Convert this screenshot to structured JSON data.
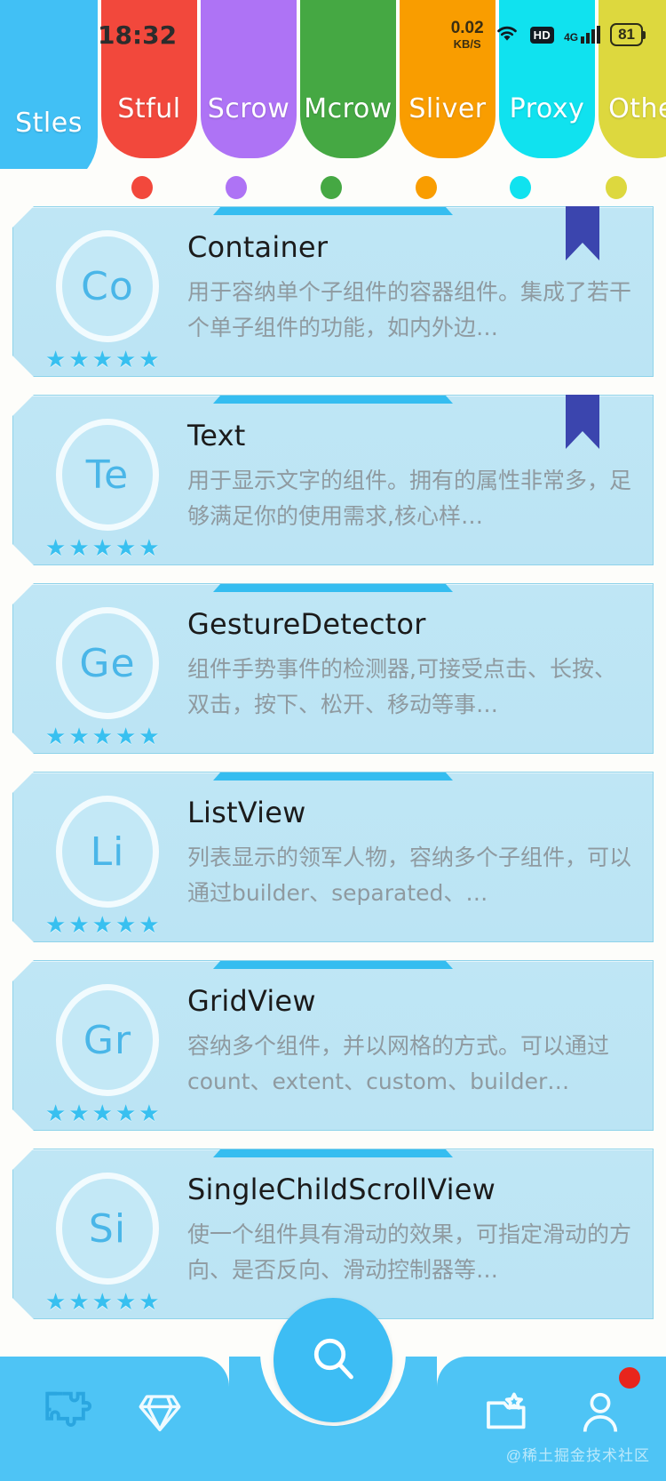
{
  "status_bar": {
    "time": "18:32",
    "net_speed_value": "0.02",
    "net_speed_unit": "KB/S",
    "wifi_icon": "wifi-icon",
    "hd_label": "HD",
    "network_type": "4G",
    "signal_icon": "signal-bars-icon",
    "battery_level": "81"
  },
  "tabs": [
    {
      "label": "Stles",
      "color": "#41c0f5",
      "dot": "",
      "active": true
    },
    {
      "label": "Stful",
      "color": "#f2483c",
      "dot": "#f2483c",
      "active": false
    },
    {
      "label": "Scrow",
      "color": "#ae73f5",
      "dot": "#ae73f5",
      "active": false
    },
    {
      "label": "Mcrow",
      "color": "#45a843",
      "dot": "#45a843",
      "active": false
    },
    {
      "label": "Sliver",
      "color": "#f99d00",
      "dot": "#f99d00",
      "active": false
    },
    {
      "label": "Proxy",
      "color": "#10e2ef",
      "dot": "#10e2ef",
      "active": false
    },
    {
      "label": "Other",
      "color": "#ddd83e",
      "dot": "#ddd83e",
      "active": false
    }
  ],
  "cards": [
    {
      "avatar": "Co",
      "title": "Container",
      "desc": "用于容纳单个子组件的容器组件。集成了若干个单子组件的功能，如内外边…",
      "stars": "★★★★★",
      "bookmarked": true
    },
    {
      "avatar": "Te",
      "title": "Text",
      "desc": "用于显示文字的组件。拥有的属性非常多，足够满足你的使用需求,核心样…",
      "stars": "★★★★★",
      "bookmarked": true
    },
    {
      "avatar": "Ge",
      "title": "GestureDetector",
      "desc": "组件手势事件的检测器,可接受点击、长按、双击，按下、松开、移动等事…",
      "stars": "★★★★★",
      "bookmarked": false
    },
    {
      "avatar": "Li",
      "title": "ListView",
      "desc": "列表显示的领军人物，容纳多个子组件，可以通过builder、separated、…",
      "stars": "★★★★★",
      "bookmarked": false
    },
    {
      "avatar": "Gr",
      "title": "GridView",
      "desc": "容纳多个组件，并以网格的方式。可以通过count、extent、custom、builder…",
      "stars": "★★★★★",
      "bookmarked": false
    },
    {
      "avatar": "Si",
      "title": "SingleChildScrollView",
      "desc": "使一个组件具有滑动的效果，可指定滑动的方向、是否反向、滑动控制器等…",
      "stars": "★★★★★",
      "bookmarked": false
    }
  ],
  "bottom_nav": {
    "items": [
      {
        "icon": "puzzle-icon",
        "active": true
      },
      {
        "icon": "diamond-icon",
        "active": false
      },
      {
        "icon": "folder-star-icon",
        "active": false
      },
      {
        "icon": "person-icon",
        "active": false,
        "badge": true
      }
    ],
    "fab_icon": "search-icon"
  },
  "watermark": "@稀土掘金技术社区",
  "colors": {
    "accent": "#3dbdf4",
    "card_bg": "#bfe6f5",
    "card_border": "#8fd3ea",
    "star": "#38c0f0",
    "ribbon": "#3b45ae",
    "badge": "#e8251c"
  }
}
